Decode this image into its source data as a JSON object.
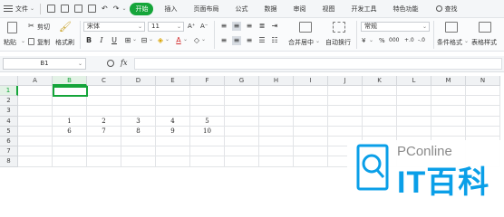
{
  "menubar": {
    "file_label": "文件",
    "tabs": [
      "开始",
      "插入",
      "页面布局",
      "公式",
      "数据",
      "审阅",
      "视图",
      "开发工具",
      "特色功能"
    ],
    "active_tab": "开始",
    "search_label": "查找"
  },
  "ribbon": {
    "paste_label": "粘贴",
    "cut_label": "剪切",
    "copy_label": "复制",
    "format_painter_label": "格式刷",
    "font_name": "宋体",
    "font_size": "11",
    "font_grow": "A⁺",
    "font_shrink": "A⁻",
    "bold": "B",
    "italic": "I",
    "underline": "U",
    "fill_glyph": "◈",
    "font_color_glyph": "A",
    "merge_center_label": "合并居中",
    "wrap_text_label": "自动换行",
    "number_format": "常规",
    "currency_glyph": "¥",
    "percent_glyph": "%",
    "thousands_glyph": "000",
    "dec_inc": "+.0",
    "dec_dec": "-.0",
    "conditional_format_label": "条件格式",
    "table_style_label": "表格样式"
  },
  "formula_bar": {
    "name_box": "B1",
    "fx_label": "fx",
    "formula_value": ""
  },
  "sheet": {
    "columns": [
      "A",
      "B",
      "C",
      "D",
      "E",
      "F",
      "G",
      "H",
      "I",
      "J",
      "K",
      "L",
      "M",
      "N"
    ],
    "rows": [
      "1",
      "2",
      "3",
      "4",
      "5",
      "6",
      "7",
      "8"
    ],
    "selected_col": "B",
    "selected_row": "1",
    "row4": [
      "1",
      "2",
      "3",
      "4",
      "5"
    ],
    "row5": [
      "6",
      "7",
      "8",
      "9",
      "10"
    ]
  },
  "watermark": {
    "brand_small": "PConline",
    "brand_large": "IT百科"
  },
  "colors": {
    "accent": "#15a53a",
    "watermark_blue": "#0a9fe8"
  }
}
